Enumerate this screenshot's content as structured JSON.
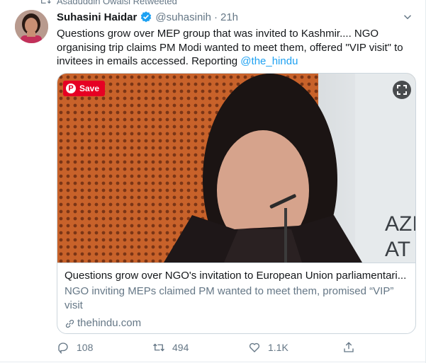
{
  "retweet_context": {
    "text": "Asaduddin Owaisi Retweeted",
    "icon": "retweet-icon"
  },
  "tweet": {
    "author_name": "Suhasini Haidar",
    "verified": true,
    "handle": "@suhasinih",
    "separator": "·",
    "time": "21h",
    "text_prefix": "Questions grow over MEP group that was invited to Kashmir.... NGO organising trip claims PM Modi wanted to meet them, offered \"VIP visit\" to invitees in emails accessed. Reporting ",
    "mention": "@the_hindu"
  },
  "card": {
    "pinterest_save_label": "Save",
    "title": "Questions grow over NGO's invitation to European Union parliamentari...",
    "description": "NGO inviting MEPs claimed PM wanted to meet them, promised “VIP” visit",
    "domain": "thehindu.com"
  },
  "actions": {
    "reply_count": "108",
    "retweet_count": "494",
    "like_count": "1.1K"
  },
  "colors": {
    "accent": "#1da1f2",
    "muted": "#657786",
    "pinterest": "#e60023"
  }
}
